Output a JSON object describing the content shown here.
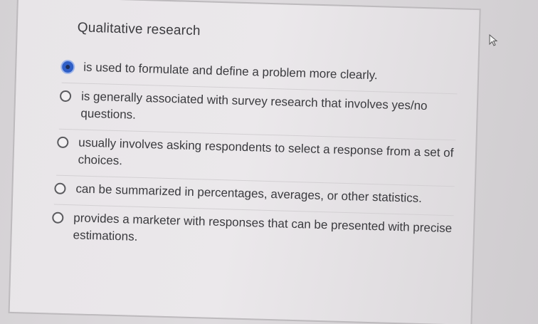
{
  "question": {
    "title": "Qualitative research"
  },
  "options": [
    {
      "label": "is used to formulate and define a problem more clearly.",
      "selected": true
    },
    {
      "label": "is generally associated with survey research that involves yes/no questions.",
      "selected": false
    },
    {
      "label": "usually involves asking respondents to select a response from a set of choices.",
      "selected": false
    },
    {
      "label": "can be summarized in percentages, averages, or other statistics.",
      "selected": false
    },
    {
      "label": "provides a marketer with responses that can be presented with precise estimations.",
      "selected": false
    }
  ],
  "icons": {
    "cursor": "mouse-pointer-icon",
    "radio": "radio-button-icon"
  },
  "colors": {
    "selected_radio": "#2f5fc7",
    "text": "#3a3a3e"
  }
}
